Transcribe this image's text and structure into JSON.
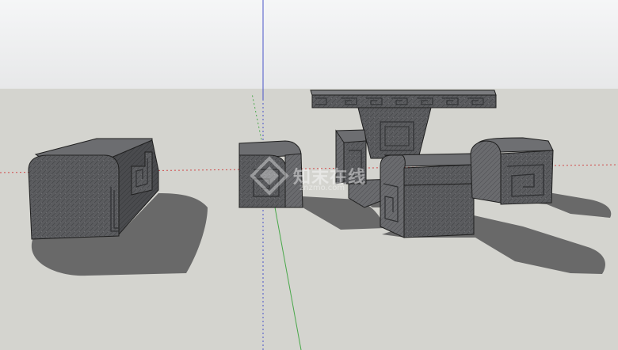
{
  "scene": {
    "sky_color": "#f3f4f5",
    "sky_bottom_color": "#e9eaeb",
    "ground_color": "#d4d4cf",
    "shadow_color": "#696969",
    "stone_dark": "#4f5053",
    "stone_mid": "#5d5e61",
    "stone_light": "#727376",
    "edge_color": "#1f1f1f",
    "axis_red": "#d04848",
    "axis_green": "#49a84a",
    "axis_blue": "#4a55c8"
  },
  "objects": [
    {
      "name": "stone-bench-long",
      "kind": "bench"
    },
    {
      "name": "stone-stool-front-left",
      "kind": "stool"
    },
    {
      "name": "stone-table",
      "kind": "table"
    },
    {
      "name": "stone-stool-back",
      "kind": "stool"
    },
    {
      "name": "stone-stool-front-right",
      "kind": "stool"
    },
    {
      "name": "stone-stool-right",
      "kind": "stool"
    }
  ],
  "watermark": {
    "text": "知末在线",
    "sub": "znzmo.com"
  }
}
